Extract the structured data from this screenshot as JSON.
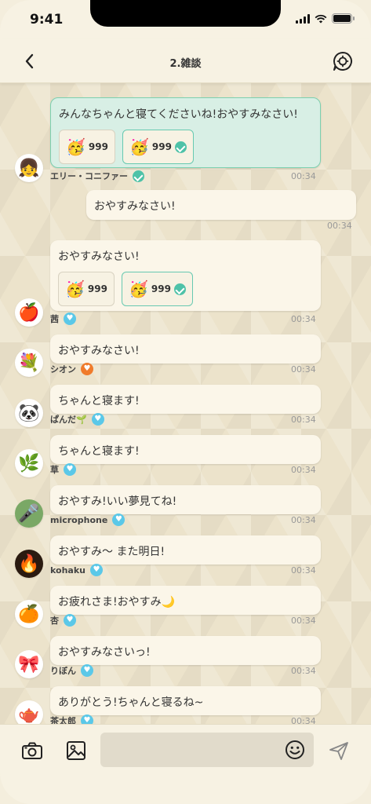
{
  "status_bar": {
    "time": "9:41"
  },
  "header": {
    "title": "2.雑談"
  },
  "messages": [
    {
      "text": "みんなちゃんと寝てくださいね!おやすみなさい!",
      "reactions": [
        {
          "emoji": "🥳",
          "count": "999",
          "mine": false
        },
        {
          "emoji": "🥳",
          "count": "999",
          "mine": true
        }
      ],
      "author": "エリー・コニファー",
      "time": "00:34",
      "avatar": "👧"
    },
    {
      "text": "おやすみなさい!",
      "time": "00:34",
      "own": true
    },
    {
      "text": "おやすみなさい!",
      "reactions": [
        {
          "emoji": "🥳",
          "count": "999",
          "mine": false
        },
        {
          "emoji": "🥳",
          "count": "999",
          "mine": true
        }
      ],
      "author": "茜",
      "time": "00:34",
      "avatar": "🍎"
    },
    {
      "text": "おやすみなさい!",
      "author": "シオン",
      "time": "00:34",
      "avatar": "💐"
    },
    {
      "text": "ちゃんと寝ます!",
      "author": "ぱんだ🌱",
      "time": "00:34",
      "avatar": "🐼"
    },
    {
      "text": "ちゃんと寝ます!",
      "author": "草",
      "time": "00:34",
      "avatar": "🌿"
    },
    {
      "text": "おやすみ!いい夢見てね!",
      "author": "microphone",
      "time": "00:34",
      "avatar": "🎤"
    },
    {
      "text": "おやすみ〜 また明日!",
      "author": "kohaku",
      "time": "00:34",
      "avatar": "🔥"
    },
    {
      "text": "お疲れさま!おやすみ🌙",
      "author": "杏",
      "time": "00:34",
      "avatar": "🍊"
    },
    {
      "text": "おやすみなさいっ!",
      "author": "りぼん",
      "time": "00:34",
      "avatar": "🎀"
    },
    {
      "text": "ありがとう!ちゃんと寝るね~",
      "author": "茶太郎",
      "time": "00:34",
      "avatar": "🫖"
    }
  ],
  "composer": {
    "placeholder": ""
  },
  "colors": {
    "accent": "#4ec2a8",
    "badge": "#5bc8e8",
    "badge_orange": "#f07b2b"
  }
}
